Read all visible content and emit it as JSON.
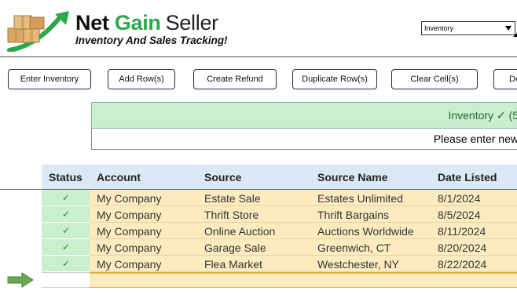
{
  "brand": {
    "net": "Net",
    "gain": "Gain",
    "seller": "Seller",
    "tagline": "Inventory And Sales Tracking!"
  },
  "sheet_select": {
    "value": "Inventory"
  },
  "toolbar": {
    "enter_inventory": "Enter Inventory",
    "add_rows": "Add Row(s)",
    "create_refund": "Create Refund",
    "duplicate_rows": "Duplicate Row(s)",
    "clear_cells": "Clear Cell(s)",
    "delete_rows": "De"
  },
  "banner": {
    "title": "Inventory ✓ (5",
    "message": "Please enter new"
  },
  "table": {
    "headers": {
      "status": "Status",
      "account": "Account",
      "source": "Source",
      "source_name": "Source Name",
      "date_listed": "Date Listed"
    },
    "rows": [
      {
        "status": "✓",
        "account": "My Company",
        "source": "Estate Sale",
        "source_name": "Estates Unlimited",
        "date_listed": "8/1/2024"
      },
      {
        "status": "✓",
        "account": "My Company",
        "source": "Thrift Store",
        "source_name": "Thrift Bargains",
        "date_listed": "8/5/2024"
      },
      {
        "status": "✓",
        "account": "My Company",
        "source": "Online Auction",
        "source_name": "Auctions Worldwide",
        "date_listed": "8/11/2024"
      },
      {
        "status": "✓",
        "account": "My Company",
        "source": "Garage Sale",
        "source_name": "Greenwich, CT",
        "date_listed": "8/20/2024"
      },
      {
        "status": "✓",
        "account": "My Company",
        "source": "Flea Market",
        "source_name": "Westchester, NY",
        "date_listed": "8/22/2024"
      }
    ]
  },
  "colors": {
    "brand_green": "#2aa84a",
    "status_green": "#c9efcf",
    "row_fill": "#fdebc0",
    "header_fill": "#dbe9f7"
  },
  "icons": {
    "logo": "cardboard-boxes-growth-arrow-icon",
    "current_row": "right-arrow-icon",
    "dropdown": "chevron-down-icon"
  }
}
